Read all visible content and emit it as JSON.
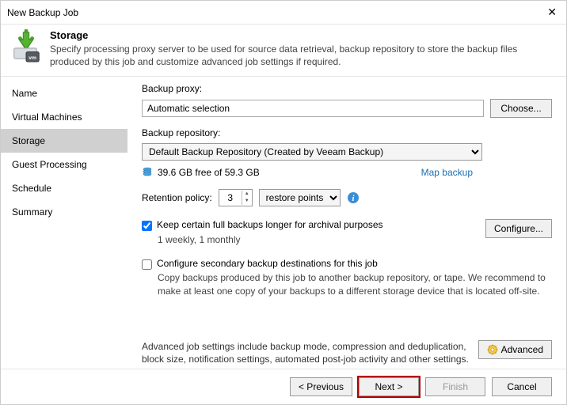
{
  "window": {
    "title": "New Backup Job"
  },
  "header": {
    "title": "Storage",
    "desc": "Specify processing proxy server to be used for source data retrieval, backup repository to store the backup files produced by this job and customize advanced job settings if required."
  },
  "sidebar": {
    "items": [
      {
        "label": "Name"
      },
      {
        "label": "Virtual Machines"
      },
      {
        "label": "Storage"
      },
      {
        "label": "Guest Processing"
      },
      {
        "label": "Schedule"
      },
      {
        "label": "Summary"
      }
    ],
    "activeIndex": 2
  },
  "main": {
    "proxy_label": "Backup proxy:",
    "proxy_value": "Automatic selection",
    "choose_label": "Choose...",
    "repo_label": "Backup repository:",
    "repo_value": "Default Backup Repository (Created by Veeam Backup)",
    "free_space": "39.6 GB free of 59.3 GB",
    "map_backup": "Map backup",
    "retention_label": "Retention policy:",
    "retention_value": "3",
    "retention_unit": "restore points",
    "keep_full_label": "Keep certain full backups longer for archival purposes",
    "keep_full_checked": true,
    "keep_full_summary": "1 weekly, 1 monthly",
    "configure_label": "Configure...",
    "secondary_label": "Configure secondary backup destinations for this job",
    "secondary_checked": false,
    "secondary_desc": "Copy backups produced by this job to another backup repository, or tape. We recommend to make at least one copy of your backups to a different storage device that is located off-site.",
    "advanced_text": "Advanced job settings include backup mode, compression and deduplication, block size, notification settings, automated post-job activity and other settings.",
    "advanced_label": "Advanced"
  },
  "footer": {
    "previous": "< Previous",
    "next": "Next >",
    "finish": "Finish",
    "cancel": "Cancel"
  }
}
